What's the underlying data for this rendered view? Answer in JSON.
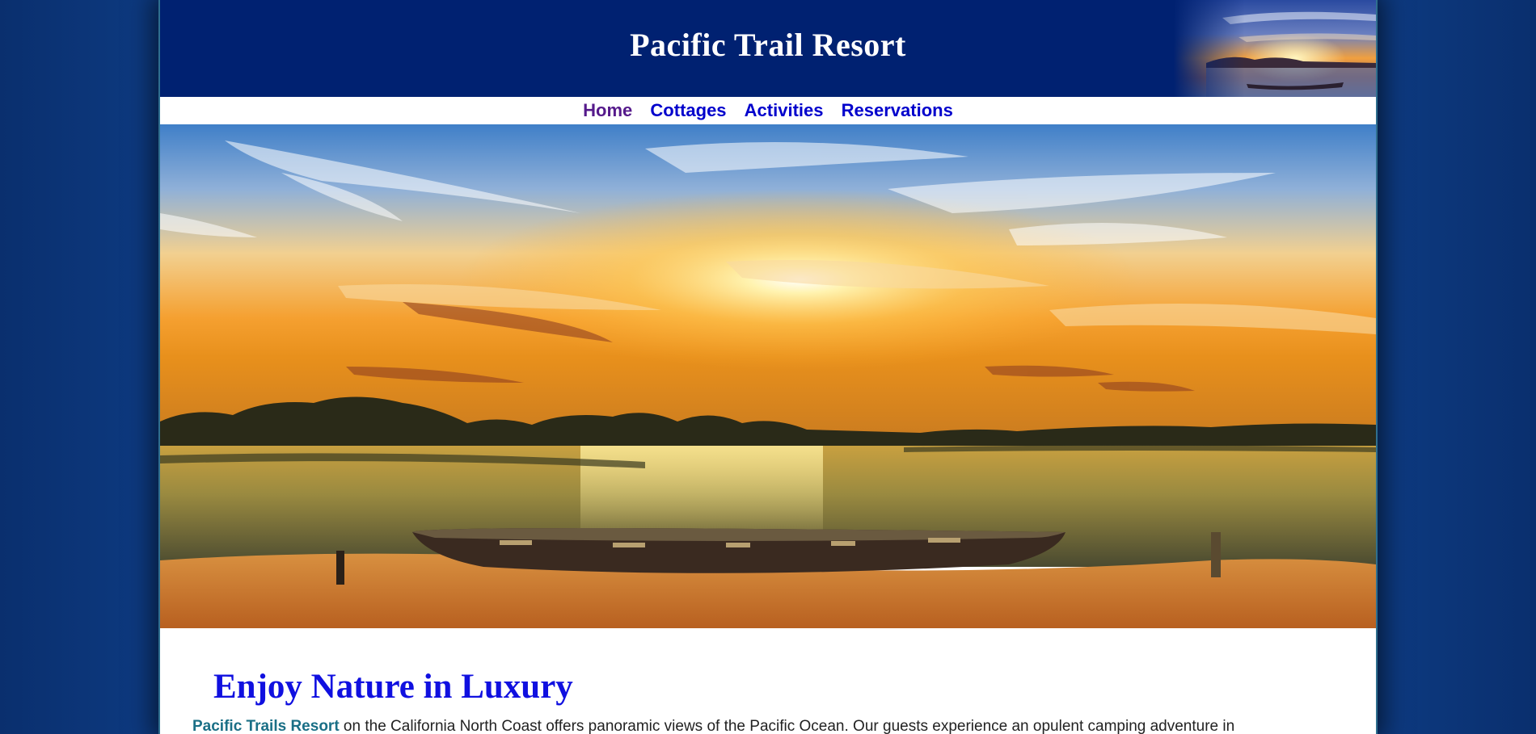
{
  "header": {
    "title": "Pacific Trail Resort",
    "header_image": "sunset-boat-thumbnail"
  },
  "nav": {
    "items": [
      {
        "label": "Home"
      },
      {
        "label": "Cottages"
      },
      {
        "label": "Activities"
      },
      {
        "label": "Reservations"
      }
    ]
  },
  "hero": {
    "image": "sunset-over-lake-with-boat"
  },
  "main": {
    "heading": "Enjoy Nature in Luxury",
    "intro_strong": "Pacific Trails Resort",
    "intro_text": " on the California North Coast offers panoramic views of the Pacific Ocean. Our guests experience an opulent camping adventure in"
  },
  "colors": {
    "page_background": "#0b3479",
    "header_background": "#002171",
    "nav_link": "#0000cc",
    "nav_link_visited": "#551a8b",
    "heading": "#1010e0",
    "resort_name": "#1a6f86"
  }
}
